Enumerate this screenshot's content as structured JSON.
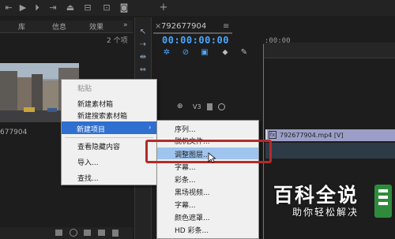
{
  "project_panel": {
    "tabs": [
      "库",
      "信息",
      "效果"
    ],
    "more": "»",
    "item_count": "2 个项",
    "clip_name": "677904"
  },
  "context_menu": {
    "items": [
      {
        "label": "粘贴",
        "disabled": true
      },
      {
        "label": "新建素材箱"
      },
      {
        "label": "新建搜索素材箱"
      },
      {
        "label": "新建项目",
        "highlighted": true,
        "submenu": true
      },
      {
        "label": "查看隐藏内容"
      },
      {
        "label": "导入..."
      },
      {
        "label": "查找..."
      }
    ],
    "submenu_arrow": "›"
  },
  "submenu": {
    "items": [
      {
        "label": "序列..."
      },
      {
        "label": "脱机文件..."
      },
      {
        "label": "调整图层...",
        "highlighted": true
      },
      {
        "label": "字幕..."
      },
      {
        "label": "彩条..."
      },
      {
        "label": "黑场视频..."
      },
      {
        "label": "字幕..."
      },
      {
        "label": "颜色遮罩..."
      },
      {
        "label": "HD 彩条..."
      }
    ]
  },
  "timeline": {
    "close": "×",
    "sequence_name": "792677904",
    "menu": "≡",
    "timecode": "00:00:00:00",
    "ruler_time": ":00:00",
    "track_label": "V3",
    "clip_label": "792677904.mp4 [V]",
    "clip_icon": "fx"
  },
  "watermark": {
    "title": "百科全说",
    "subtitle": "助你轻松解决"
  },
  "colors": {
    "accent": "#4aa8ff",
    "menu_highlight": "#2f6fcf",
    "annotation_red": "#b62a2a",
    "clip_color": "#9c9ec8"
  },
  "icons": {
    "play": "play-icon",
    "step": "step-forward-icon",
    "camera": "camera-icon",
    "add": "plus-icon"
  }
}
